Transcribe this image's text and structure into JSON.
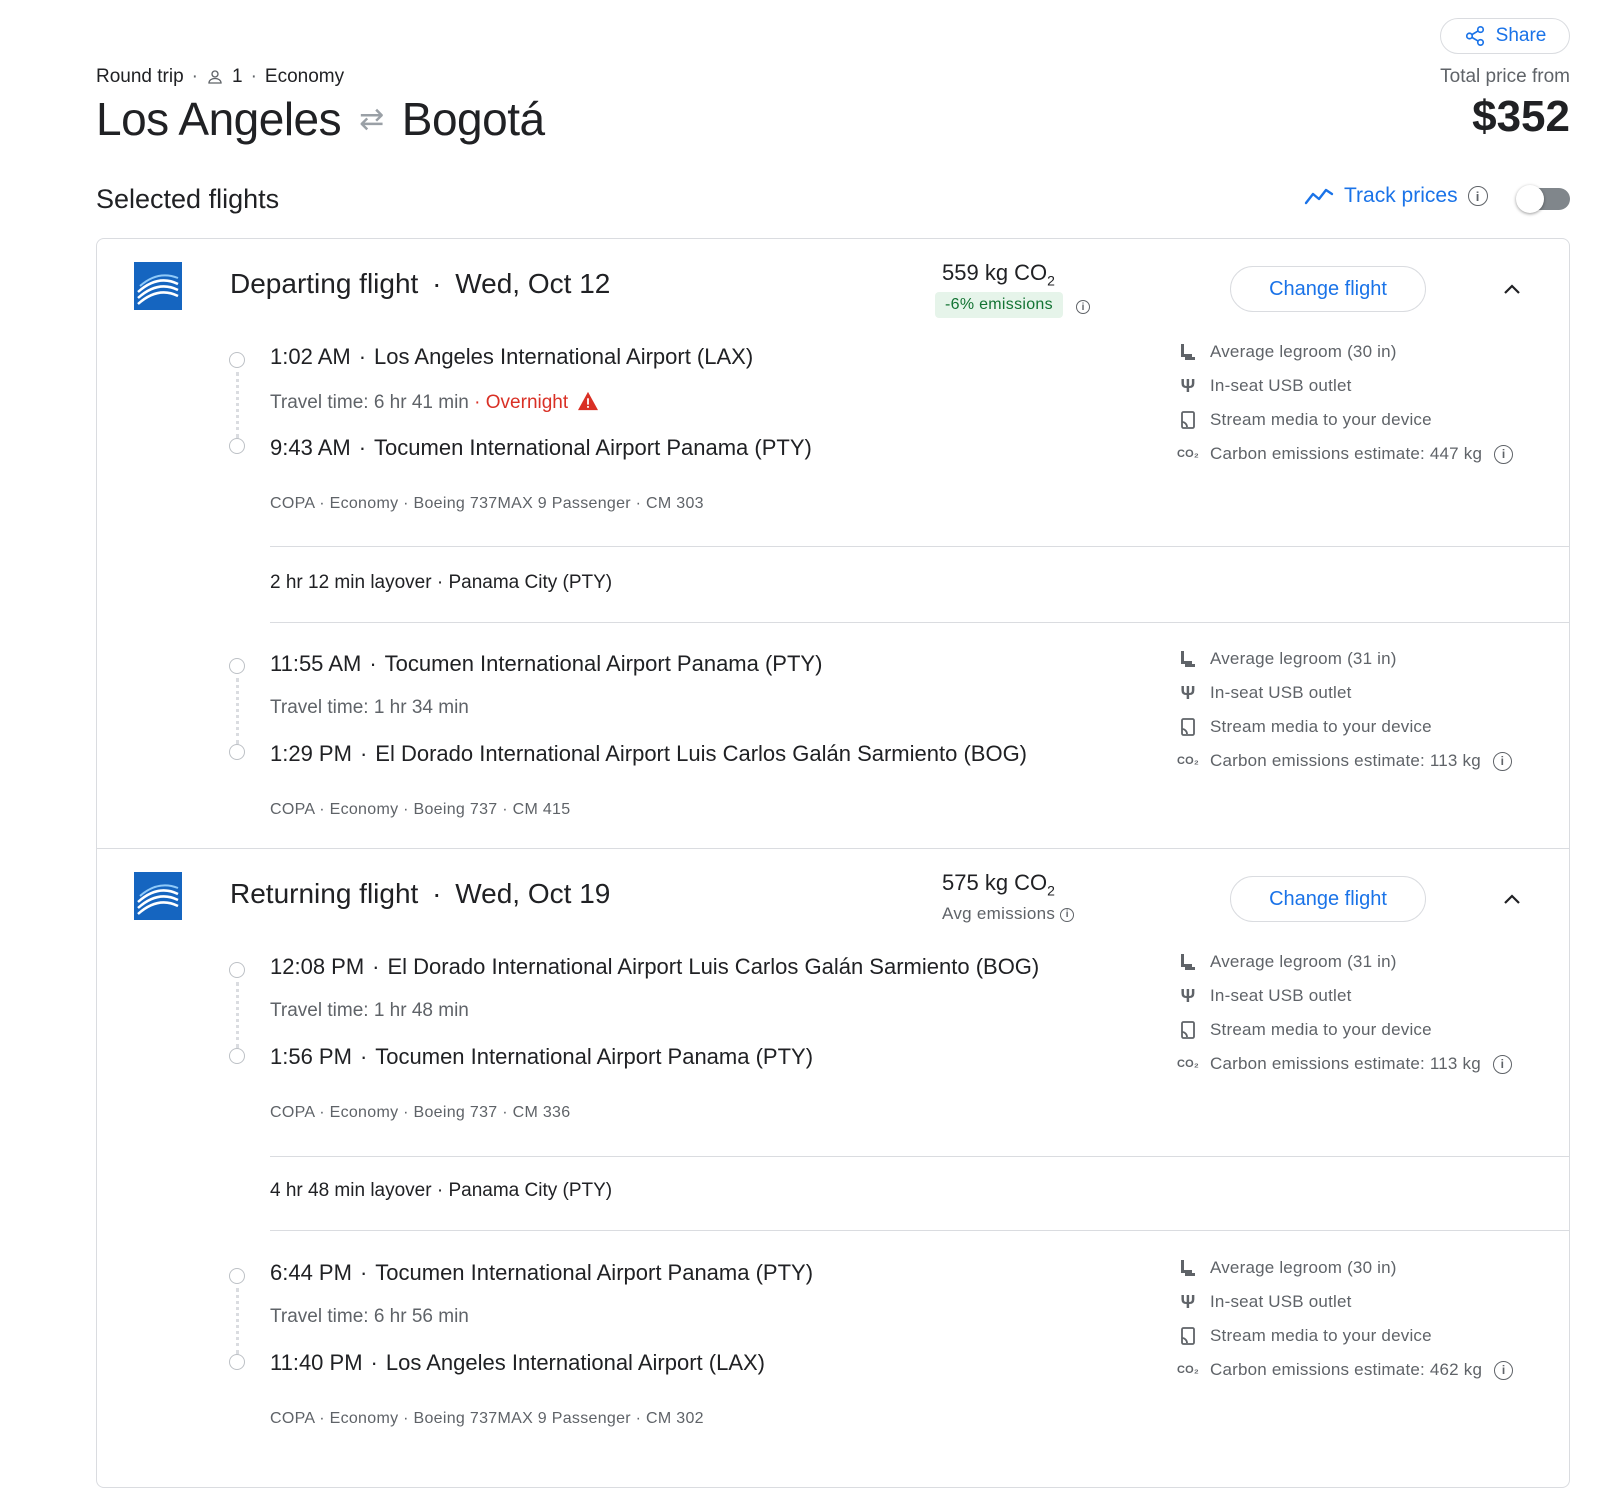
{
  "header": {
    "share_label": "Share",
    "trip_type": "Round trip",
    "passengers": "1",
    "cabin": "Economy",
    "origin": "Los Angeles",
    "destination": "Bogotá",
    "price_label": "Total price from",
    "price": "$352"
  },
  "selected": {
    "title": "Selected flights",
    "track_label": "Track prices"
  },
  "colors": {
    "accent": "#1a73e8",
    "warning": "#d93025",
    "success_bg": "#e6f4ea",
    "success_text": "#137333"
  },
  "departing": {
    "title": "Departing flight",
    "date": "Wed, Oct 12",
    "co2": "559 kg CO",
    "co2_sub": "2",
    "emissions": "-6% emissions",
    "change_label": "Change flight",
    "segments": [
      {
        "dep_time": "1:02 AM",
        "dep_airport": "Los Angeles International Airport (LAX)",
        "travel": "Travel time: 6 hr 41 min",
        "overnight": "Overnight",
        "arr_time": "9:43 AM",
        "arr_airport": "Tocumen International Airport Panama (PTY)",
        "info": "COPA · Economy · Boeing 737MAX 9 Passenger · CM 303",
        "legroom": "Average legroom (30 in)",
        "usb": "In-seat USB outlet",
        "stream": "Stream media to your device",
        "carbon": "Carbon emissions estimate: 447 kg"
      },
      {
        "dep_time": "11:55 AM",
        "dep_airport": "Tocumen International Airport Panama (PTY)",
        "travel": "Travel time: 1 hr 34 min",
        "arr_time": "1:29 PM",
        "arr_airport": "El Dorado International Airport Luis Carlos Galán Sarmiento (BOG)",
        "info": "COPA · Economy · Boeing 737 · CM 415",
        "legroom": "Average legroom (31 in)",
        "usb": "In-seat USB outlet",
        "stream": "Stream media to your device",
        "carbon": "Carbon emissions estimate: 113 kg"
      }
    ],
    "layover": "2 hr 12 min layover · Panama City (PTY)"
  },
  "returning": {
    "title": "Returning flight",
    "date": "Wed, Oct 19",
    "co2": "575 kg CO",
    "co2_sub": "2",
    "emissions": "Avg emissions",
    "change_label": "Change flight",
    "segments": [
      {
        "dep_time": "12:08 PM",
        "dep_airport": "El Dorado International Airport Luis Carlos Galán Sarmiento (BOG)",
        "travel": "Travel time: 1 hr 48 min",
        "arr_time": "1:56 PM",
        "arr_airport": "Tocumen International Airport Panama (PTY)",
        "info": "COPA · Economy · Boeing 737 · CM 336",
        "legroom": "Average legroom (31 in)",
        "usb": "In-seat USB outlet",
        "stream": "Stream media to your device",
        "carbon": "Carbon emissions estimate: 113 kg"
      },
      {
        "dep_time": "6:44 PM",
        "dep_airport": "Tocumen International Airport Panama (PTY)",
        "travel": "Travel time: 6 hr 56 min",
        "arr_time": "11:40 PM",
        "arr_airport": "Los Angeles International Airport (LAX)",
        "info": "COPA · Economy · Boeing 737MAX 9 Passenger · CM 302",
        "legroom": "Average legroom (30 in)",
        "usb": "In-seat USB outlet",
        "stream": "Stream media to your device",
        "carbon": "Carbon emissions estimate: 462 kg"
      }
    ],
    "layover": "4 hr 48 min layover · Panama City (PTY)"
  }
}
